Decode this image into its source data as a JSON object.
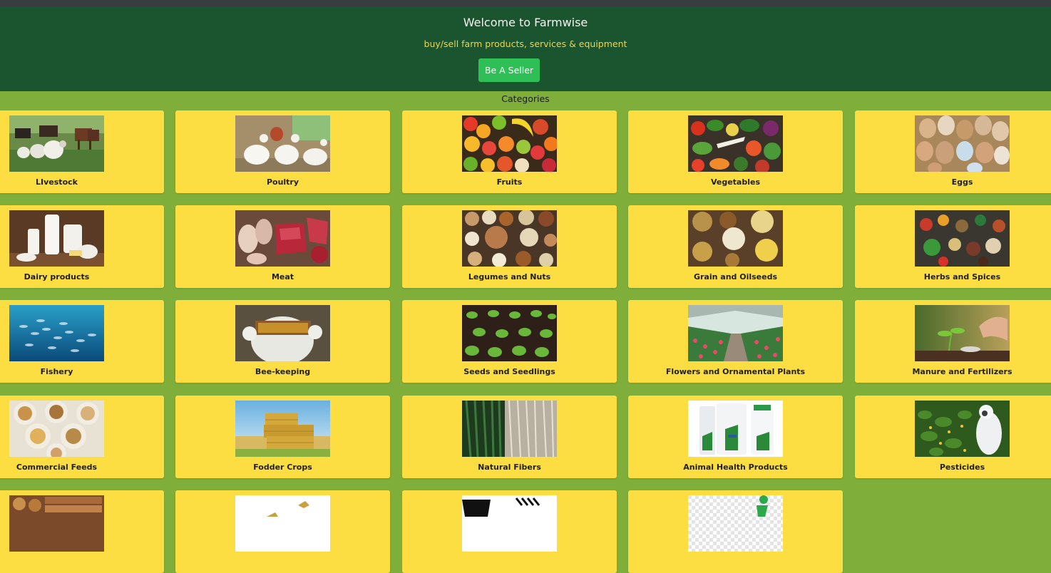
{
  "header": {
    "title": "Welcome to Farmwise",
    "tagline": "buy/sell farm products, services & equipment",
    "seller_button": "Be A Seller"
  },
  "categories_heading": "Categories",
  "colors": {
    "header_bg": "#1b5530",
    "page_bg": "#7fae3a",
    "card_bg": "#fcdd42",
    "tagline": "#f1d24b",
    "button": "#2fbf57"
  },
  "categories": [
    {
      "label": "LIvestock",
      "icon": "livestock-image"
    },
    {
      "label": "Poultry",
      "icon": "poultry-image"
    },
    {
      "label": "Fruits",
      "icon": "fruits-image"
    },
    {
      "label": "Vegetables",
      "icon": "vegetables-image"
    },
    {
      "label": "Eggs",
      "icon": "eggs-image"
    },
    {
      "label": "Dairy products",
      "icon": "dairy-image"
    },
    {
      "label": "Meat",
      "icon": "meat-image"
    },
    {
      "label": "Legumes and Nuts",
      "icon": "legumes-image"
    },
    {
      "label": "Grain and Oilseeds",
      "icon": "grain-image"
    },
    {
      "label": "Herbs and Spices",
      "icon": "herbs-image"
    },
    {
      "label": "Fishery",
      "icon": "fishery-image"
    },
    {
      "label": "Bee-keeping",
      "icon": "beekeeping-image"
    },
    {
      "label": "Seeds and Seedlings",
      "icon": "seedlings-image"
    },
    {
      "label": "Flowers and Ornamental Plants",
      "icon": "flowers-image"
    },
    {
      "label": "Manure and Fertilizers",
      "icon": "fertilizer-image"
    },
    {
      "label": "Commercial Feeds",
      "icon": "feeds-image"
    },
    {
      "label": "Fodder Crops",
      "icon": "fodder-image"
    },
    {
      "label": "Natural Fibers",
      "icon": "fibers-image"
    },
    {
      "label": "Animal Health Products",
      "icon": "animal-health-image"
    },
    {
      "label": "Pesticides",
      "icon": "pesticides-image"
    },
    {
      "label": "",
      "icon": "timber-image"
    },
    {
      "label": "",
      "icon": "bird-image"
    },
    {
      "label": "",
      "icon": "tools-image"
    },
    {
      "label": "",
      "icon": "person-image"
    }
  ]
}
